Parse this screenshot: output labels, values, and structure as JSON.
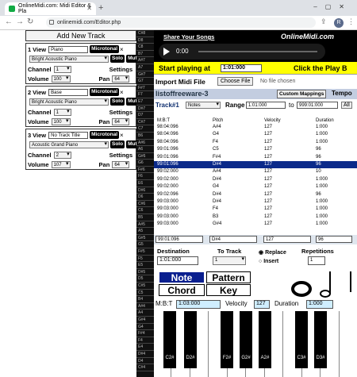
{
  "browser": {
    "tab_title": "OnlineMidi.com: Midi Editor & Pla",
    "url": "onlinemidi.com/Editor.php",
    "new_tab": "+",
    "profile_initial": "R"
  },
  "left": {
    "add_track": "Add New Track",
    "view_label": "View",
    "microtonal": "Microtonal",
    "solo": "Solo",
    "mute": "Mute",
    "channel_label": "Channel",
    "volume_label": "Volume",
    "pan_label": "Pan",
    "settings": "Settings",
    "close": "×",
    "tracks": [
      {
        "num": "1",
        "name": "Piano",
        "instrument": "Bright Acoustic Piano",
        "channel": "1",
        "volume": "100",
        "pan": "64"
      },
      {
        "num": "2",
        "name": "Base",
        "instrument": "Bright Acoustic Piano",
        "channel": "1",
        "volume": "100",
        "pan": "64"
      },
      {
        "num": "3",
        "name": "No Track Title",
        "instrument": "Acoustic Grand Piano",
        "channel": "2",
        "volume": "107",
        "pan": "64"
      }
    ]
  },
  "strip_keys": [
    "C#8",
    "D8",
    "C8",
    "B7",
    "A#7",
    "A7",
    "G#7",
    "G7",
    "F#7",
    "F7",
    "E7",
    "D#7",
    "D7",
    "C#7",
    "C7",
    "B6",
    "A#6",
    "A6",
    "G#6",
    "G6",
    "F#6",
    "F6",
    "E6",
    "D#6",
    "D6",
    "C#6",
    "C6",
    "B5",
    "A#5",
    "A5",
    "G#5",
    "G5",
    "F#5",
    "F5",
    "E5",
    "D#5",
    "D5",
    "C#5",
    "C5",
    "B4",
    "A#4",
    "A4",
    "G#4",
    "G4",
    "F#4",
    "F4",
    "E4",
    "D#4",
    "D4",
    "C#4"
  ],
  "app": {
    "share": "Share Your Songs",
    "logo": "OnlineMidi.com",
    "time": "0:00",
    "start_label": "Start playing at",
    "start_value": "1:01:000",
    "play_hint": "Click the Play B",
    "import_label": "Import Midi File",
    "choose_file": "Choose File",
    "no_file": "No file chosen",
    "song_title": "listoffreeware-3",
    "custom_mappings": "Custom Mappings",
    "tempo": "Tempo",
    "track_label": "Track#1",
    "notes_select": "Notes",
    "range_label": "Range",
    "range_from": "1:01:000",
    "to_label": "to",
    "range_to": "999:01:000",
    "all": "All",
    "headers": [
      "M:B:T",
      "Pitch",
      "Velocity",
      "Duration"
    ],
    "rows": [
      [
        "98:04:096",
        "A#4",
        "127",
        "1:000"
      ],
      [
        "98:04:096",
        "G4",
        "127",
        "1:000"
      ],
      [
        "98:04:096",
        "F4",
        "127",
        "1:000"
      ],
      [
        "99:01:096",
        "C5",
        "127",
        "96"
      ],
      [
        "99:01:096",
        "F#4",
        "127",
        "96"
      ],
      [
        "99:01:096",
        "D#4",
        "127",
        "96"
      ],
      [
        "99:02:000",
        "A#4",
        "127",
        "10"
      ],
      [
        "99:02:000",
        "D#4",
        "127",
        "1:000"
      ],
      [
        "99:02:000",
        "G4",
        "127",
        "1:000"
      ],
      [
        "99:02:096",
        "D#4",
        "127",
        "96"
      ],
      [
        "99:03:000",
        "D#4",
        "127",
        "1:000"
      ],
      [
        "99:03:000",
        "F4",
        "127",
        "1:000"
      ],
      [
        "99:03:000",
        "B3",
        "127",
        "1:000"
      ],
      [
        "99:03:000",
        "G#4",
        "127",
        "1:000"
      ]
    ],
    "edit_row": [
      "99:01:096",
      "D#4",
      "127",
      "96"
    ],
    "destination_label": "Destination",
    "destination_value": "1:01:000",
    "to_track_label": "To Track",
    "to_track_value": "1",
    "replace": "Replace",
    "insert": "Insert",
    "repetitions_label": "Repetitions",
    "repetitions_value": "1",
    "note_btn": "Note",
    "pattern_btn": "Pattern",
    "chord_btn": "Chord",
    "key_btn": "Key",
    "mbt_label": "M:B:T",
    "mbt_value": "1:03:000",
    "velocity_label": "Velocity",
    "velocity_value": "127",
    "duration_label": "Duration",
    "duration_value": "1:000",
    "black_keys": [
      "C2#",
      "D2#",
      "F2#",
      "G2#",
      "A2#",
      "C3#",
      "D3#"
    ]
  }
}
